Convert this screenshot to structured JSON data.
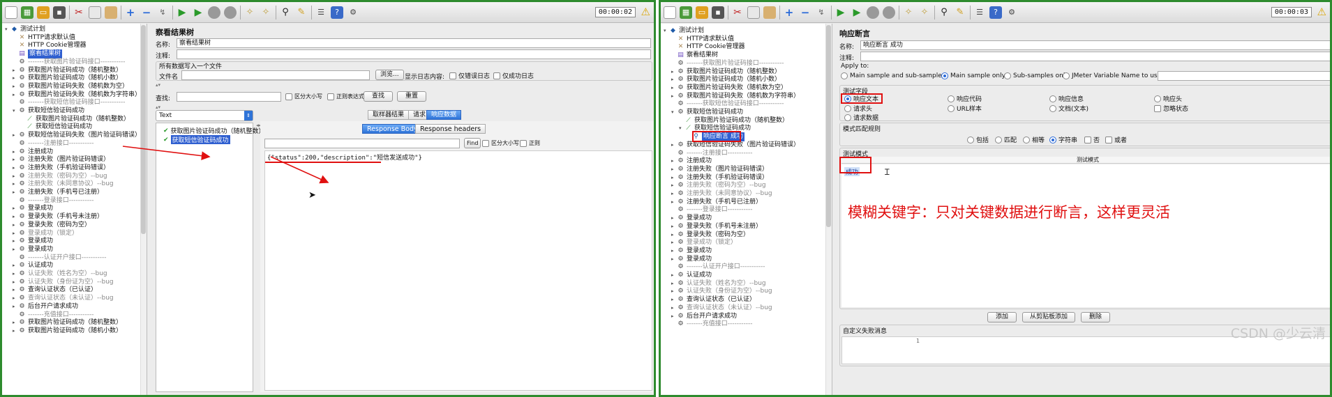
{
  "timer_left": "00:00:02",
  "timer_right": "00:00:03",
  "tree_left": [
    {
      "label": "测试计划",
      "icon": "root",
      "indent": 0,
      "tw": "▾"
    },
    {
      "label": "HTTP请求默认值",
      "icon": "http",
      "indent": 1,
      "tw": ""
    },
    {
      "label": "HTTP Cookie管理器",
      "icon": "http",
      "indent": 1,
      "tw": ""
    },
    {
      "label": "察看结果树",
      "icon": "view",
      "indent": 1,
      "tw": "",
      "sel": true
    },
    {
      "label": "-------获取图片验证码接口-----------",
      "icon": "gear",
      "indent": 1,
      "tw": "",
      "dis": true
    },
    {
      "label": "获取图片验证码成功（随机整数）",
      "icon": "gear",
      "indent": 1,
      "tw": "▸"
    },
    {
      "label": "获取图片验证码成功（随机小数）",
      "icon": "gear",
      "indent": 1,
      "tw": "▸"
    },
    {
      "label": "获取图片验证码失败（随机数为空）",
      "icon": "gear",
      "indent": 1,
      "tw": "▸"
    },
    {
      "label": "获取图片验证码失败（随机数为字符串）",
      "icon": "gear",
      "indent": 1,
      "tw": "▸"
    },
    {
      "label": "-------获取短信验证码接口-----------",
      "icon": "gear",
      "indent": 1,
      "tw": "",
      "dis": true
    },
    {
      "label": "获取短信验证码成功",
      "icon": "gear",
      "indent": 1,
      "tw": "▾"
    },
    {
      "label": "获取图片验证码成功（随机整数）",
      "icon": "pipe",
      "indent": 2,
      "tw": ""
    },
    {
      "label": "获取短信验证码成功",
      "icon": "pipe",
      "indent": 2,
      "tw": ""
    },
    {
      "label": "获取短信验证码失败（图片验证码错误）",
      "icon": "gear",
      "indent": 1,
      "tw": "▸"
    },
    {
      "label": "-------注册接口-----------",
      "icon": "gear",
      "indent": 1,
      "tw": "",
      "dis": true
    },
    {
      "label": "注册成功",
      "icon": "gear",
      "indent": 1,
      "tw": "▸"
    },
    {
      "label": "注册失败（图片验证码错误）",
      "icon": "gear",
      "indent": 1,
      "tw": "▸"
    },
    {
      "label": "注册失败（手机验证码错误）",
      "icon": "gear",
      "indent": 1,
      "tw": "▸"
    },
    {
      "label": "注册失败（密码为空）--bug",
      "icon": "gear",
      "indent": 1,
      "tw": "▸",
      "dis": true
    },
    {
      "label": "注册失败（未同意协议）--bug",
      "icon": "gear",
      "indent": 1,
      "tw": "▸",
      "dis": true
    },
    {
      "label": "注册失败（手机号已注册）",
      "icon": "gear",
      "indent": 1,
      "tw": "▸"
    },
    {
      "label": "-------登录接口-----------",
      "icon": "gear",
      "indent": 1,
      "tw": "",
      "dis": true
    },
    {
      "label": "登录成功",
      "icon": "gear",
      "indent": 1,
      "tw": "▸"
    },
    {
      "label": "登录失败（手机号未注册）",
      "icon": "gear",
      "indent": 1,
      "tw": "▸"
    },
    {
      "label": "登录失败（密码为空）",
      "icon": "gear",
      "indent": 1,
      "tw": "▸"
    },
    {
      "label": "登录成功（锁定）",
      "icon": "gear",
      "indent": 1,
      "tw": "▸",
      "dis": true
    },
    {
      "label": "登录成功",
      "icon": "gear",
      "indent": 1,
      "tw": "▸"
    },
    {
      "label": "登录成功",
      "icon": "gear",
      "indent": 1,
      "tw": "▸"
    },
    {
      "label": "-------认证开户接口-----------",
      "icon": "gear",
      "indent": 1,
      "tw": "",
      "dis": true
    },
    {
      "label": "认证成功",
      "icon": "gear",
      "indent": 1,
      "tw": "▸"
    },
    {
      "label": "认证失败（姓名为空）--bug",
      "icon": "gear",
      "indent": 1,
      "tw": "▸",
      "dis": true
    },
    {
      "label": "认证失败（身份证为空）--bug",
      "icon": "gear",
      "indent": 1,
      "tw": "▸",
      "dis": true
    },
    {
      "label": "查询认证状态（已认证）",
      "icon": "gear",
      "indent": 1,
      "tw": "▸"
    },
    {
      "label": "查询认证状态（未认证）--bug",
      "icon": "gear",
      "indent": 1,
      "tw": "▸",
      "dis": true
    },
    {
      "label": "后台开户请求成功",
      "icon": "gear",
      "indent": 1,
      "tw": "▸"
    },
    {
      "label": "-------充值接口-----------",
      "icon": "gear",
      "indent": 1,
      "tw": "",
      "dis": true
    },
    {
      "label": "获取图片验证码成功（随机整数）",
      "icon": "gear",
      "indent": 1,
      "tw": "▸"
    },
    {
      "label": "获取图片验证码成功（随机小数）",
      "icon": "gear",
      "indent": 1,
      "tw": "▸"
    }
  ],
  "tree_right": [
    {
      "label": "测试计划",
      "icon": "root",
      "indent": 0,
      "tw": "▾"
    },
    {
      "label": "HTTP请求默认值",
      "icon": "http",
      "indent": 1,
      "tw": ""
    },
    {
      "label": "HTTP Cookie管理器",
      "icon": "http",
      "indent": 1,
      "tw": ""
    },
    {
      "label": "察看结果树",
      "icon": "view",
      "indent": 1,
      "tw": ""
    },
    {
      "label": "-------获取图片验证码接口-----------",
      "icon": "gear",
      "indent": 1,
      "tw": "",
      "dis": true
    },
    {
      "label": "获取图片验证码成功（随机整数）",
      "icon": "gear",
      "indent": 1,
      "tw": "▸"
    },
    {
      "label": "获取图片验证码成功（随机小数）",
      "icon": "gear",
      "indent": 1,
      "tw": "▸"
    },
    {
      "label": "获取图片验证码失败（随机数为空）",
      "icon": "gear",
      "indent": 1,
      "tw": "▸"
    },
    {
      "label": "获取图片验证码失败（随机数为字符串）",
      "icon": "gear",
      "indent": 1,
      "tw": "▸"
    },
    {
      "label": "-------获取短信验证码接口-----------",
      "icon": "gear",
      "indent": 1,
      "tw": "",
      "dis": true
    },
    {
      "label": "获取短信验证码成功",
      "icon": "gear",
      "indent": 1,
      "tw": "▾"
    },
    {
      "label": "获取图片验证码成功（随机整数）",
      "icon": "pipe",
      "indent": 2,
      "tw": ""
    },
    {
      "label": "获取短信验证码成功",
      "icon": "pipe",
      "indent": 2,
      "tw": "▾"
    },
    {
      "label": "响应断言 成功",
      "icon": "assert",
      "indent": 3,
      "tw": "",
      "sel": true
    },
    {
      "label": "获取短信验证码失败（图片验证码错误）",
      "icon": "gear",
      "indent": 1,
      "tw": "▸"
    },
    {
      "label": "-------注册接口-----------",
      "icon": "gear",
      "indent": 1,
      "tw": "",
      "dis": true
    },
    {
      "label": "注册成功",
      "icon": "gear",
      "indent": 1,
      "tw": "▸"
    },
    {
      "label": "注册失败（图片验证码错误）",
      "icon": "gear",
      "indent": 1,
      "tw": "▸"
    },
    {
      "label": "注册失败（手机验证码错误）",
      "icon": "gear",
      "indent": 1,
      "tw": "▸"
    },
    {
      "label": "注册失败（密码为空）--bug",
      "icon": "gear",
      "indent": 1,
      "tw": "▸",
      "dis": true
    },
    {
      "label": "注册失败（未同意协议）--bug",
      "icon": "gear",
      "indent": 1,
      "tw": "▸",
      "dis": true
    },
    {
      "label": "注册失败（手机号已注册）",
      "icon": "gear",
      "indent": 1,
      "tw": "▸"
    },
    {
      "label": "-------登录接口-----------",
      "icon": "gear",
      "indent": 1,
      "tw": "",
      "dis": true
    },
    {
      "label": "登录成功",
      "icon": "gear",
      "indent": 1,
      "tw": "▸"
    },
    {
      "label": "登录失败（手机号未注册）",
      "icon": "gear",
      "indent": 1,
      "tw": "▸"
    },
    {
      "label": "登录失败（密码为空）",
      "icon": "gear",
      "indent": 1,
      "tw": "▸"
    },
    {
      "label": "登录成功（锁定）",
      "icon": "gear",
      "indent": 1,
      "tw": "▸",
      "dis": true
    },
    {
      "label": "登录成功",
      "icon": "gear",
      "indent": 1,
      "tw": "▸"
    },
    {
      "label": "登录成功",
      "icon": "gear",
      "indent": 1,
      "tw": "▸"
    },
    {
      "label": "-------认证开户接口-----------",
      "icon": "gear",
      "indent": 1,
      "tw": "",
      "dis": true
    },
    {
      "label": "认证成功",
      "icon": "gear",
      "indent": 1,
      "tw": "▸"
    },
    {
      "label": "认证失败（姓名为空）--bug",
      "icon": "gear",
      "indent": 1,
      "tw": "▸",
      "dis": true
    },
    {
      "label": "认证失败（身份证为空）--bug",
      "icon": "gear",
      "indent": 1,
      "tw": "▸",
      "dis": true
    },
    {
      "label": "查询认证状态（已认证）",
      "icon": "gear",
      "indent": 1,
      "tw": "▸"
    },
    {
      "label": "查询认证状态（未认证）--bug",
      "icon": "gear",
      "indent": 1,
      "tw": "▸",
      "dis": true
    },
    {
      "label": "后台开户请求成功",
      "icon": "gear",
      "indent": 1,
      "tw": "▸"
    },
    {
      "label": "-------充值接口-----------",
      "icon": "gear",
      "indent": 1,
      "tw": "",
      "dis": true
    }
  ],
  "results_tree": {
    "title": "察看结果树",
    "name_label": "名称:",
    "name_value": "察看结果树",
    "comment_label": "注释:",
    "all_data_label": "所有数据写入一个文件",
    "filename_label": "文件名",
    "browse_button": "浏览...",
    "log_label": "显示日志内容:",
    "errors_only": "仅错误日志",
    "success_only": "仅成功日志",
    "search_label": "查找:",
    "case_sensitive": "区分大小写",
    "regex": "正则表达式",
    "find_button": "查找",
    "reset_button": "重置",
    "renderer_value": "Text",
    "results": [
      "获取图片验证码成功（随机整数）",
      "获取短信验证码成功"
    ],
    "tabs": [
      "取样器结果",
      "请求",
      "响应数据"
    ],
    "subtabs": [
      "Response Body",
      "Response headers"
    ],
    "find_small_button": "Find",
    "case_small": "区分大小写",
    "regex_small": "正则",
    "response_body": "{\"status\":200,\"description\":\"短信发送成功\"}"
  },
  "assertion": {
    "title": "响应断言",
    "name_label": "名称:",
    "name_value": "响应断言 成功",
    "comment_label": "注释:",
    "apply_to_label": "Apply to:",
    "apply_options": [
      "Main sample and sub-samples",
      "Main sample only",
      "Sub-samples only",
      "JMeter Variable Name to use"
    ],
    "field_section": "测试字段",
    "field_options": [
      "响应文本",
      "响应代码",
      "响应信息",
      "响应头",
      "请求头",
      "URL样本",
      "文档(文本)",
      "忽略状态",
      "请求数据"
    ],
    "rule_section": "模式匹配规则",
    "rule_options": [
      "包括",
      "匹配",
      "相等",
      "字符串",
      "否",
      "或者"
    ],
    "pattern_section": "测试模式",
    "pattern_header": "测试模式",
    "pattern_value": "成功",
    "add_button": "添加",
    "paste_button": "从剪贴板添加",
    "delete_button": "删除",
    "custom_fail_label": "自定义失败消息",
    "row_number": "1"
  },
  "annotation_text": "模糊关键字：只对关键数据进行断言，这样更灵活",
  "watermark": "CSDN @少云清",
  "colors": {
    "border_green": "#2e8b2e",
    "annotation_red": "#e01010",
    "selection_blue": "#2f5fd0"
  }
}
